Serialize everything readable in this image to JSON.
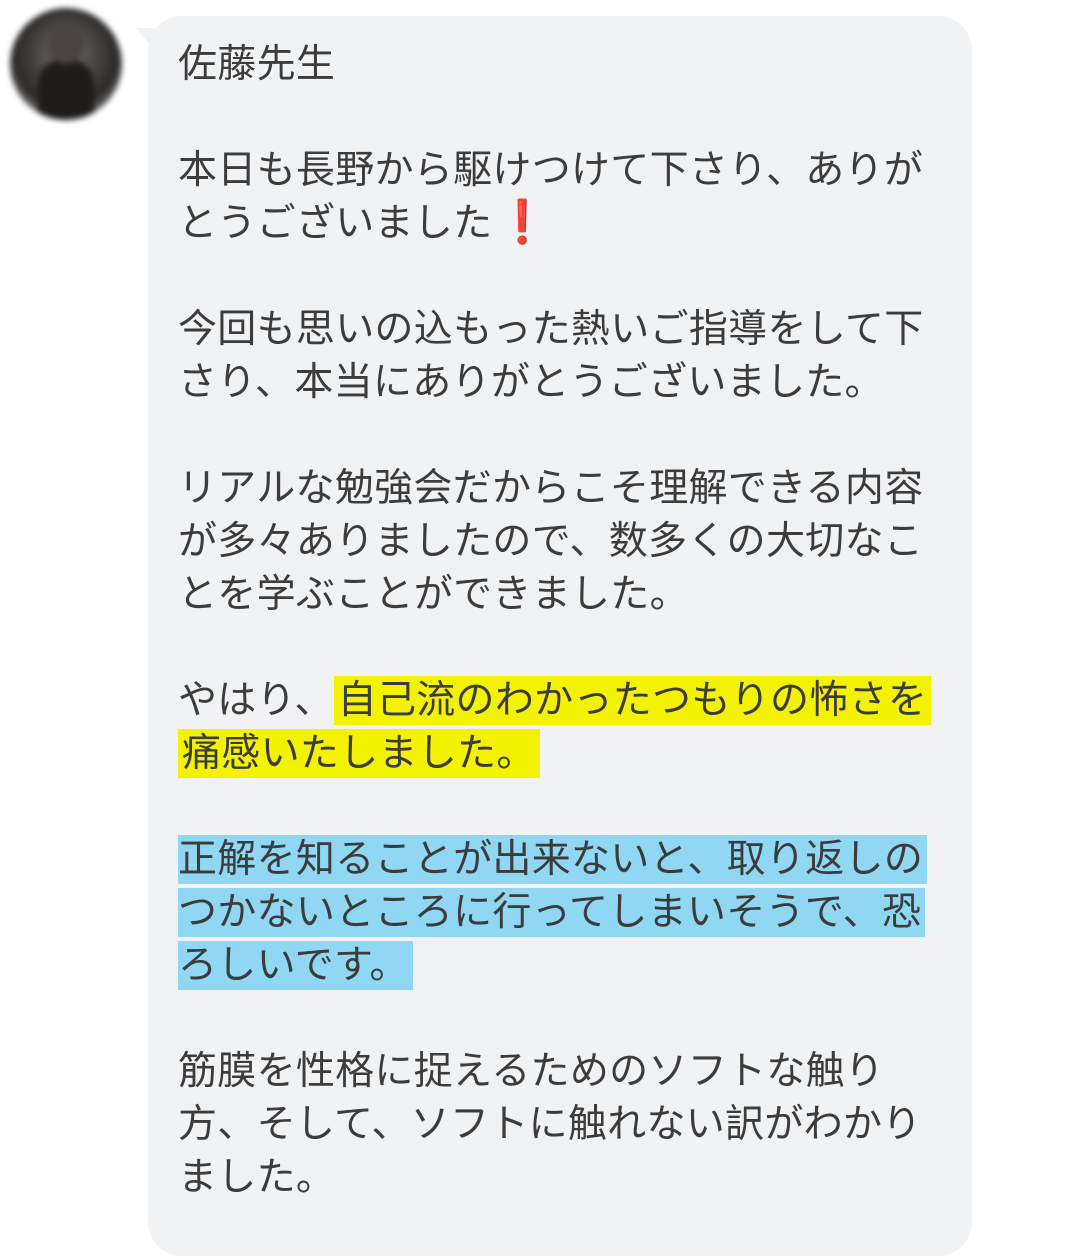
{
  "chat": {
    "sender": "佐藤先生",
    "avatar_icon": "avatar-photo-blurred",
    "emoji_icon": "exclamation-mark-icon",
    "paragraphs": [
      {
        "text": "本日も長野から駆けつけて下さり、ありがとうございました"
      },
      {
        "text": "今回も思いの込もった熱いご指導をして下さり、本当にありがとうございました。"
      },
      {
        "text": "リアルな勉強会だからこそ理解できる内容が多々ありましたので、数多くの大切なことを学ぶことができました。"
      },
      {
        "before_highlight": "やはり、",
        "highlight_yellow": "自己流のわかったつもりの怖さを痛感いたしました。"
      },
      {
        "highlight_blue": "正解を知ることが出来ないと、取り返しのつかないところに行ってしまいそうで、恐ろしいです。"
      },
      {
        "text": "筋膜を性格に捉えるためのソフトな触り方、そして、ソフトに触れない訳がわかりました。"
      }
    ],
    "colors": {
      "bubble": "#f1f2f4",
      "text": "#3c3c3c",
      "highlight_yellow": "#f3f300",
      "highlight_blue": "#8fd7f2",
      "emoji_red": "#e02020"
    }
  }
}
